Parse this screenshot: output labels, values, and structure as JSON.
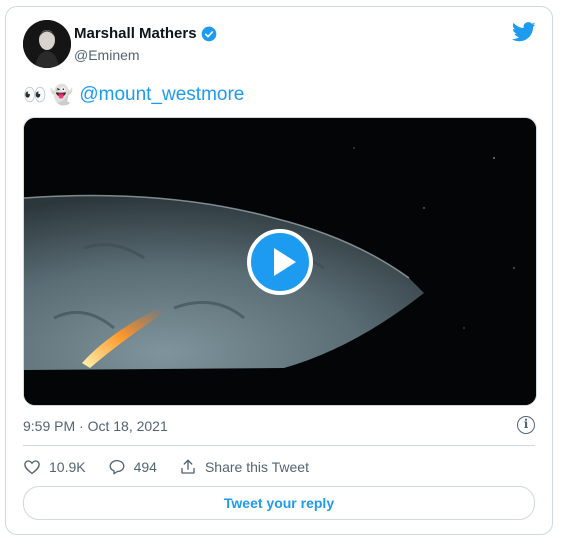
{
  "author": {
    "name": "Marshall Mathers",
    "handle": "@Eminem",
    "verified": true
  },
  "tweet": {
    "emojis": [
      "👀",
      "👻"
    ],
    "mention": "@mount_westmore"
  },
  "media": {
    "type": "video",
    "play_icon": "play-icon"
  },
  "meta": {
    "timestamp": "9:59 PM · Oct 18, 2021"
  },
  "actions": {
    "likes": "10.9K",
    "replies": "494",
    "share_label": "Share this Tweet"
  },
  "reply_button": "Tweet your reply",
  "colors": {
    "accent": "#1d9bf0",
    "muted": "#536471",
    "border": "#cfd9de"
  }
}
